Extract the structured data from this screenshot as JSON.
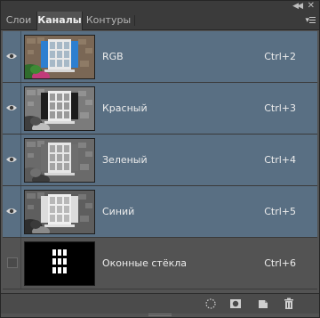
{
  "window": {
    "collapse_icon": "double-chevron-icon",
    "close_icon": "close-icon"
  },
  "tabs": [
    {
      "label": "Слои",
      "active": false
    },
    {
      "label": "Каналы",
      "active": true
    },
    {
      "label": "Контуры",
      "active": false
    }
  ],
  "panel_menu_icon": "panel-menu-icon",
  "channels": [
    {
      "name": "RGB",
      "shortcut": "Ctrl+2",
      "visible": true,
      "selected": true,
      "thumb": "color"
    },
    {
      "name": "Красный",
      "shortcut": "Ctrl+3",
      "visible": true,
      "selected": true,
      "thumb": "red"
    },
    {
      "name": "Зеленый",
      "shortcut": "Ctrl+4",
      "visible": true,
      "selected": true,
      "thumb": "green"
    },
    {
      "name": "Синий",
      "shortcut": "Ctrl+5",
      "visible": true,
      "selected": true,
      "thumb": "blue"
    },
    {
      "name": "Оконные стёкла",
      "shortcut": "Ctrl+6",
      "visible": false,
      "selected": false,
      "thumb": "mask"
    }
  ],
  "footer_buttons": [
    {
      "icon": "load-selection-icon"
    },
    {
      "icon": "save-selection-icon"
    },
    {
      "icon": "new-channel-icon"
    },
    {
      "icon": "trash-icon"
    }
  ],
  "colors": {
    "selected_row": "#596f83",
    "panel_bg": "#535353",
    "tab_bar": "#3b3b3b"
  }
}
